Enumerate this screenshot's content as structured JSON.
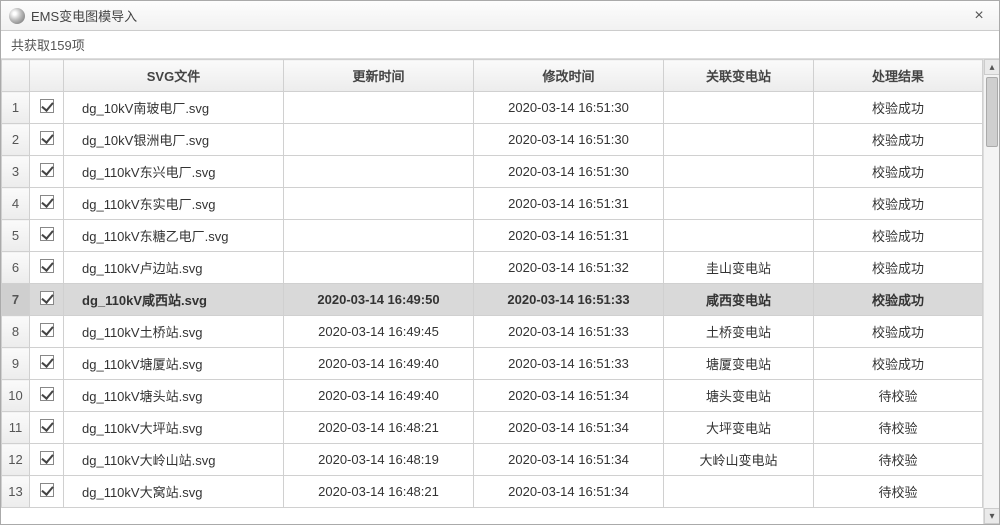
{
  "window": {
    "title": "EMS变电图模导入",
    "close_glyph": "×"
  },
  "status": {
    "count_text": "共获取159项"
  },
  "columns": {
    "svg_file": "SVG文件",
    "update_time": "更新时间",
    "modify_time": "修改时间",
    "related_station": "关联变电站",
    "result": "处理结果"
  },
  "scroll_glyphs": {
    "up": "▴",
    "down": "▾"
  },
  "rows": [
    {
      "n": "1",
      "checked": true,
      "file": "dg_10kV南玻电厂.svg",
      "update": "",
      "modify": "2020-03-14 16:51:30",
      "station": "",
      "result": "校验成功",
      "selected": false
    },
    {
      "n": "2",
      "checked": true,
      "file": "dg_10kV银洲电厂.svg",
      "update": "",
      "modify": "2020-03-14 16:51:30",
      "station": "",
      "result": "校验成功",
      "selected": false
    },
    {
      "n": "3",
      "checked": true,
      "file": "dg_110kV东兴电厂.svg",
      "update": "",
      "modify": "2020-03-14 16:51:30",
      "station": "",
      "result": "校验成功",
      "selected": false
    },
    {
      "n": "4",
      "checked": true,
      "file": "dg_110kV东实电厂.svg",
      "update": "",
      "modify": "2020-03-14 16:51:31",
      "station": "",
      "result": "校验成功",
      "selected": false
    },
    {
      "n": "5",
      "checked": true,
      "file": "dg_110kV东糖乙电厂.svg",
      "update": "",
      "modify": "2020-03-14 16:51:31",
      "station": "",
      "result": "校验成功",
      "selected": false
    },
    {
      "n": "6",
      "checked": true,
      "file": "dg_110kV卢边站.svg",
      "update": "",
      "modify": "2020-03-14 16:51:32",
      "station": "圭山变电站",
      "result": "校验成功",
      "selected": false
    },
    {
      "n": "7",
      "checked": true,
      "file": "dg_110kV咸西站.svg",
      "update": "2020-03-14 16:49:50",
      "modify": "2020-03-14 16:51:33",
      "station": "咸西变电站",
      "result": "校验成功",
      "selected": true
    },
    {
      "n": "8",
      "checked": true,
      "file": "dg_110kV土桥站.svg",
      "update": "2020-03-14 16:49:45",
      "modify": "2020-03-14 16:51:33",
      "station": "土桥变电站",
      "result": "校验成功",
      "selected": false
    },
    {
      "n": "9",
      "checked": true,
      "file": "dg_110kV塘厦站.svg",
      "update": "2020-03-14 16:49:40",
      "modify": "2020-03-14 16:51:33",
      "station": "塘厦变电站",
      "result": "校验成功",
      "selected": false
    },
    {
      "n": "10",
      "checked": true,
      "file": "dg_110kV塘头站.svg",
      "update": "2020-03-14 16:49:40",
      "modify": "2020-03-14 16:51:34",
      "station": "塘头变电站",
      "result": "待校验",
      "selected": false
    },
    {
      "n": "11",
      "checked": true,
      "file": "dg_110kV大坪站.svg",
      "update": "2020-03-14 16:48:21",
      "modify": "2020-03-14 16:51:34",
      "station": "大坪变电站",
      "result": "待校验",
      "selected": false
    },
    {
      "n": "12",
      "checked": true,
      "file": "dg_110kV大岭山站.svg",
      "update": "2020-03-14 16:48:19",
      "modify": "2020-03-14 16:51:34",
      "station": "大岭山变电站",
      "result": "待校验",
      "selected": false
    },
    {
      "n": "13",
      "checked": true,
      "file": "dg_110kV大窝站.svg",
      "update": "2020-03-14 16:48:21",
      "modify": "2020-03-14 16:51:34",
      "station": "",
      "result": "待校验",
      "selected": false
    }
  ]
}
